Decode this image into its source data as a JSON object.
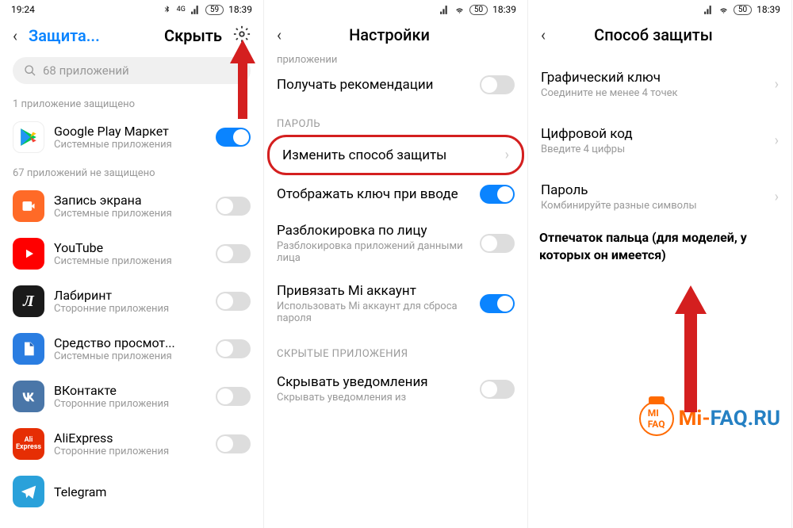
{
  "screen1": {
    "time": "19:24",
    "battery": "59",
    "clock": "18:39",
    "title1": "Защита...",
    "title2": "Скрыть",
    "searchPlaceholder": "68 приложений",
    "protectedLabel": "1 приложение защищено",
    "unprotectedLabel": "67 приложений не защищено",
    "apps": [
      {
        "name": "Google Play Маркет",
        "sub": "Системные приложения",
        "on": true
      },
      {
        "name": "Запись экрана",
        "sub": "Системные приложения",
        "on": false
      },
      {
        "name": "YouTube",
        "sub": "Системные приложения",
        "on": false
      },
      {
        "name": "Лабиринт",
        "sub": "Сторонние приложения",
        "on": false
      },
      {
        "name": "Средство просмот...",
        "sub": "Системные приложения",
        "on": false
      },
      {
        "name": "ВКонтакте",
        "sub": "Сторонние приложения",
        "on": false
      },
      {
        "name": "AliExpress",
        "sub": "Сторонние приложения",
        "on": false
      },
      {
        "name": "Telegram",
        "sub": "",
        "on": false
      }
    ]
  },
  "screen2": {
    "battery": "50",
    "clock": "18:39",
    "title": "Настройки",
    "cropped": "приложении",
    "recs": "Получать рекомендации",
    "passwordSection": "ПАРОЛЬ",
    "changeMethod": "Изменить способ защиты",
    "showKey": "Отображать ключ при вводе",
    "faceUnlock": "Разблокировка по лицу",
    "faceUnlockSub": "Разблокировка приложений данными лица",
    "miAccount": "Привязать Mi аккаунт",
    "miAccountSub": "Использовать Mi аккаунт для сброса пароля",
    "hiddenSection": "СКРЫТЫЕ ПРИЛОЖЕНИЯ",
    "hideNotif": "Скрывать уведомления",
    "hideNotifSub": "Скрывать уведомления из"
  },
  "screen3": {
    "battery": "50",
    "clock": "18:39",
    "title": "Способ защиты",
    "pattern": "Графический ключ",
    "patternSub": "Соедините не менее 4 точек",
    "pin": "Цифровой код",
    "pinSub": "Введите 4 цифры",
    "password": "Пароль",
    "passwordSub": "Комбинируйте разные символы",
    "notes": "Отпечаток пальца (для моделей, у которых он имеется)",
    "watermark1": "Mi-",
    "watermark2": "FAQ.RU"
  }
}
